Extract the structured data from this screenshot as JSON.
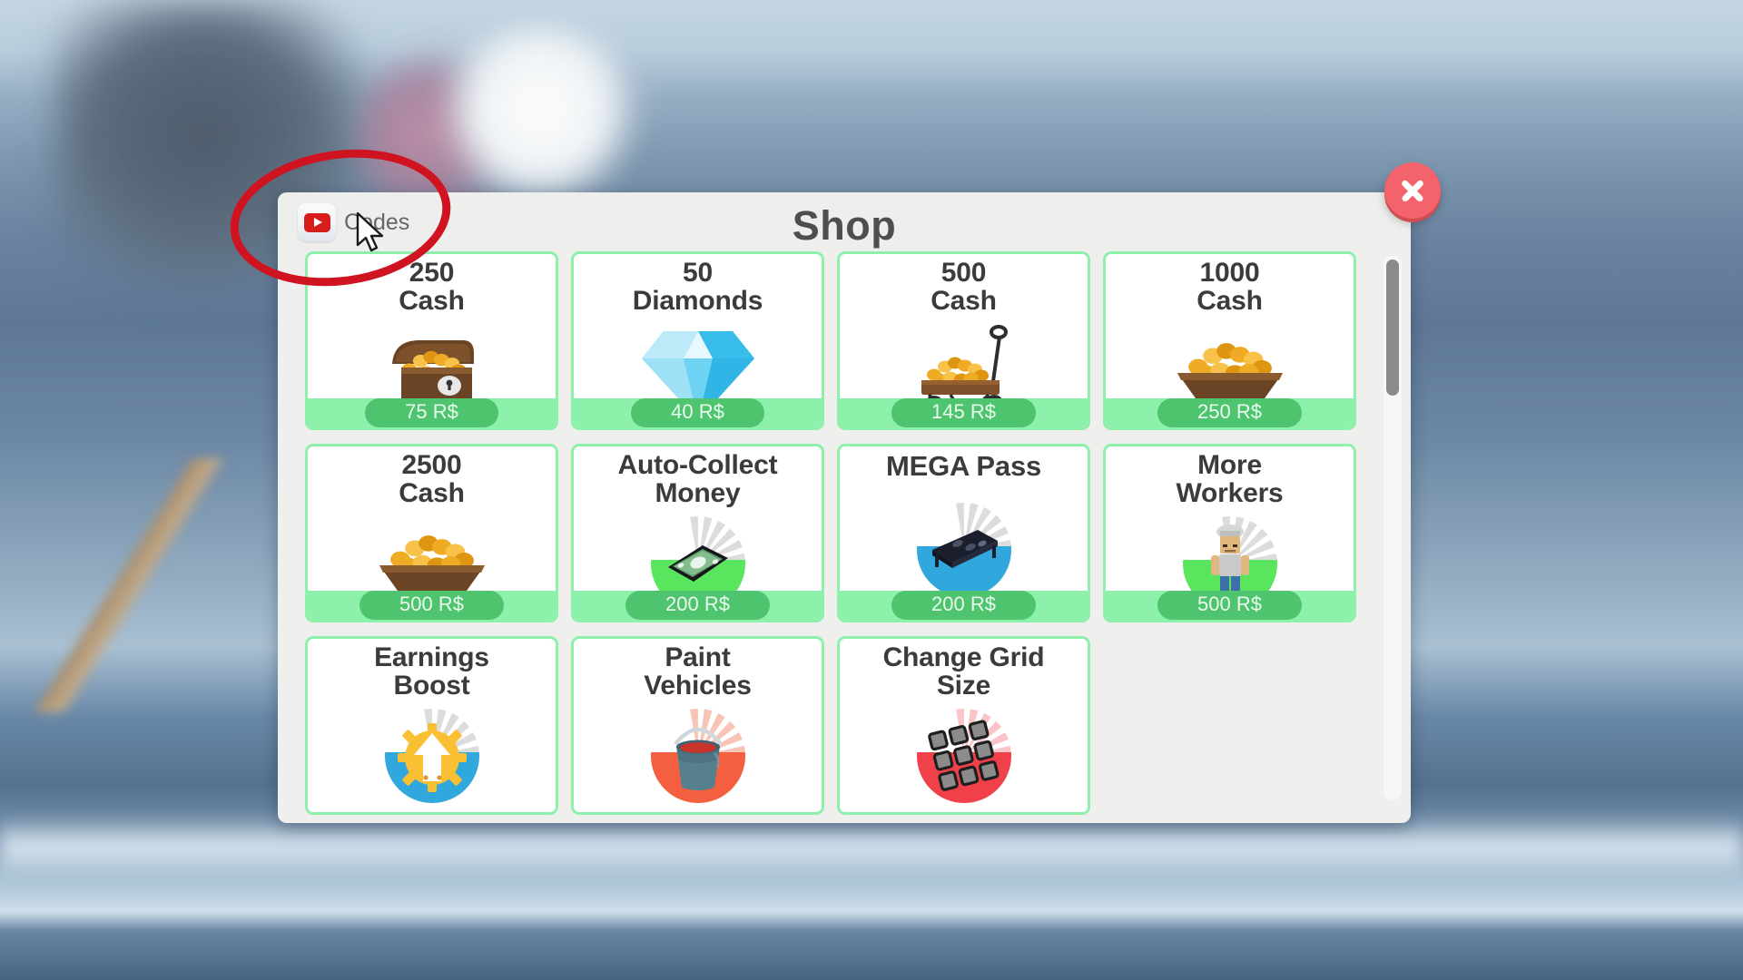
{
  "window": {
    "title": "Shop",
    "close_label": "×",
    "close_icon": "close-icon",
    "accent_green": "#8ef1ab",
    "price_pill_green": "#4fc46e",
    "close_red": "#f4636b",
    "title_color": "#4e4e4e"
  },
  "codes_button": {
    "label": "Codes",
    "icon": "youtube-icon"
  },
  "scrollbar": {
    "thumb_color": "#8b8b8b",
    "track_color": "#f7f7f7"
  },
  "annotation": {
    "shape": "ellipse",
    "color": "#cf1320"
  },
  "cursor": {
    "icon": "mouse-pointer-icon"
  },
  "items": [
    {
      "amount": "250",
      "name": "Cash",
      "title": "250\nCash",
      "price": "75 R$",
      "art": "treasure-chest-icon"
    },
    {
      "amount": "50",
      "name": "Diamonds",
      "title": "50\nDiamonds",
      "price": "40 R$",
      "art": "diamond-gem-icon"
    },
    {
      "amount": "500",
      "name": "Cash",
      "title": "500\nCash",
      "price": "145 R$",
      "art": "gold-wagon-icon"
    },
    {
      "amount": "1000",
      "name": "Cash",
      "title": "1000\nCash",
      "price": "250 R$",
      "art": "gold-boat-icon"
    },
    {
      "amount": "2500",
      "name": "Cash",
      "title": "2500\nCash",
      "price": "500 R$",
      "art": "gold-boat-icon"
    },
    {
      "amount": "",
      "name": "Auto-Collect Money",
      "title": "Auto-Collect\nMoney",
      "price": "200 R$",
      "art": "money-gamepass-badge"
    },
    {
      "amount": "",
      "name": "MEGA Pass",
      "title": "MEGA Pass",
      "price": "200 R$",
      "art": "mega-pass-badge"
    },
    {
      "amount": "",
      "name": "More Workers",
      "title": "More\nWorkers",
      "price": "500 R$",
      "art": "worker-gamepass-badge"
    },
    {
      "amount": "",
      "name": "Earnings Boost",
      "title": "Earnings\nBoost",
      "price": "",
      "art": "earnings-boost-badge"
    },
    {
      "amount": "",
      "name": "Paint Vehicles",
      "title": "Paint\nVehicles",
      "price": "",
      "art": "paint-bucket-badge"
    },
    {
      "amount": "",
      "name": "Change Grid Size",
      "title": "Change Grid\nSize",
      "price": "",
      "art": "grid-size-badge"
    }
  ]
}
